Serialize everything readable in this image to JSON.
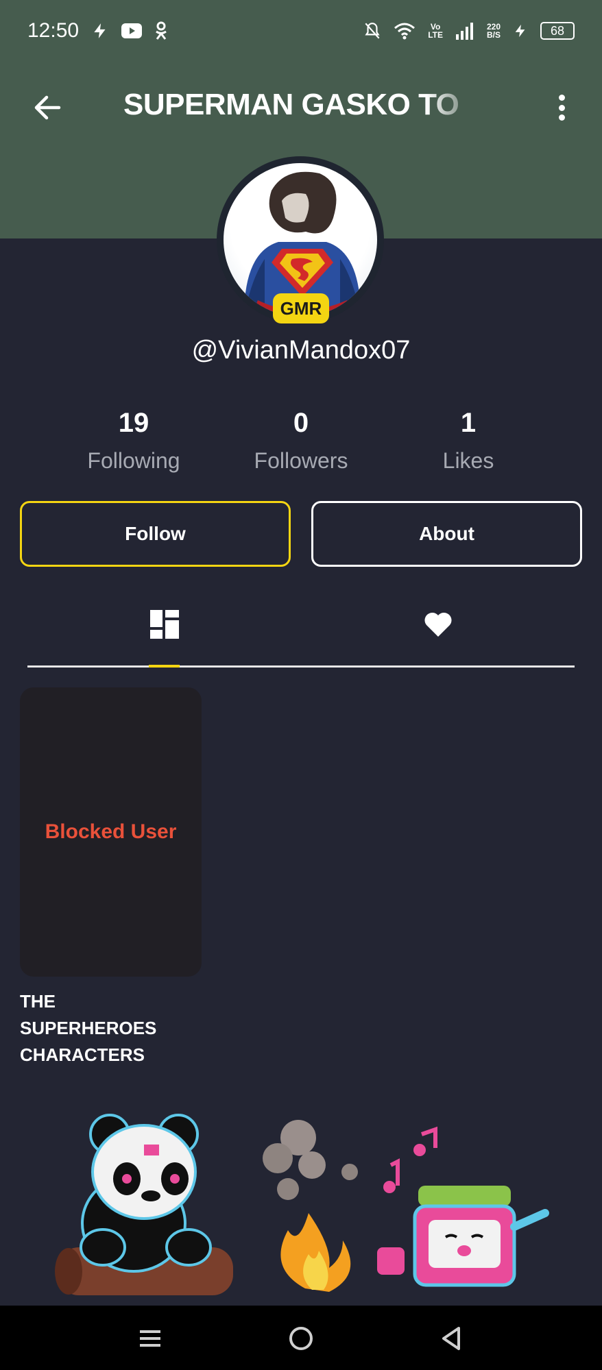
{
  "status_bar": {
    "time": "12:50",
    "battery": "68",
    "net_speed_top": "220",
    "net_speed_bottom": "B/S",
    "volte_top": "Vo",
    "volte_bottom": "LTE"
  },
  "header": {
    "title": "SUPERMAN GASKO TO",
    "back_icon": "arrow-left-icon",
    "more_icon": "more-vertical-icon"
  },
  "profile": {
    "badge": "GMR",
    "username": "@VivianMandox07"
  },
  "stats": {
    "following": {
      "value": "19",
      "label": "Following"
    },
    "followers": {
      "value": "0",
      "label": "Followers"
    },
    "likes": {
      "value": "1",
      "label": "Likes"
    }
  },
  "actions": {
    "follow_label": "Follow",
    "about_label": "About"
  },
  "tabs": [
    {
      "icon": "grid-icon",
      "active": true
    },
    {
      "icon": "heart-icon",
      "active": false
    }
  ],
  "videos": [
    {
      "overlay": "Blocked User",
      "caption": "THE SUPERHEROES CHARACTERS"
    }
  ],
  "nav_bar": {
    "icons": [
      "menu-icon",
      "home-circle-icon",
      "back-triangle-icon"
    ]
  },
  "colors": {
    "header_bg": "#465c4e",
    "page_bg": "#232533",
    "accent_yellow": "#f4d512",
    "blocked_red": "#e9513a"
  }
}
